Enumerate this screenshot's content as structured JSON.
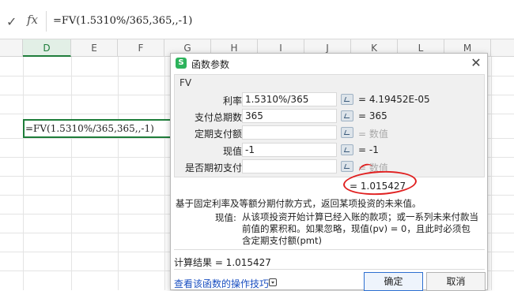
{
  "formula_bar": {
    "confirm_icon": "check-icon",
    "fx_label": "fx",
    "formula": "=FV(1.5310%/365,365,,-1)"
  },
  "columns": [
    "D",
    "E",
    "F",
    "G",
    "H",
    "I",
    "J",
    "K",
    "L",
    "M"
  ],
  "selected_column": "D",
  "active_cell": {
    "content": "=FV(1.5310%/365,365,,-1)"
  },
  "dialog": {
    "title": "函数参数",
    "function_name": "FV",
    "params": [
      {
        "label": "利率",
        "value": "1.5310%/365",
        "result": "= 4.19452E-05",
        "placeholder_result": false
      },
      {
        "label": "支付总期数",
        "value": "365",
        "result": "= 365",
        "placeholder_result": false
      },
      {
        "label": "定期支付额",
        "value": "",
        "result": "= 数值",
        "placeholder_result": true
      },
      {
        "label": "现值",
        "value": "-1",
        "result": "= -1",
        "placeholder_result": false
      },
      {
        "label": "是否期初支付",
        "value": "",
        "result": "= 数值",
        "placeholder_result": true
      }
    ],
    "formula_result": "= 1.015427",
    "description": "基于固定利率及等额分期付款方式，返回某项投资的未来值。",
    "param_desc_label": "现值:",
    "param_desc": "从该项投资开始计算已经入账的款项；或一系列未来付款当前值的累积和。如果忽略，现值(pv) = 0，且此时必须包含定期支付额(pmt)",
    "calc_result": "计算结果 = 1.015427",
    "help_link": "查看该函数的操作技巧",
    "ok_label": "确定",
    "cancel_label": "取消"
  },
  "colors": {
    "accent": "#1e7d3a",
    "annotation": "#e02020",
    "link": "#1a4fc0"
  }
}
